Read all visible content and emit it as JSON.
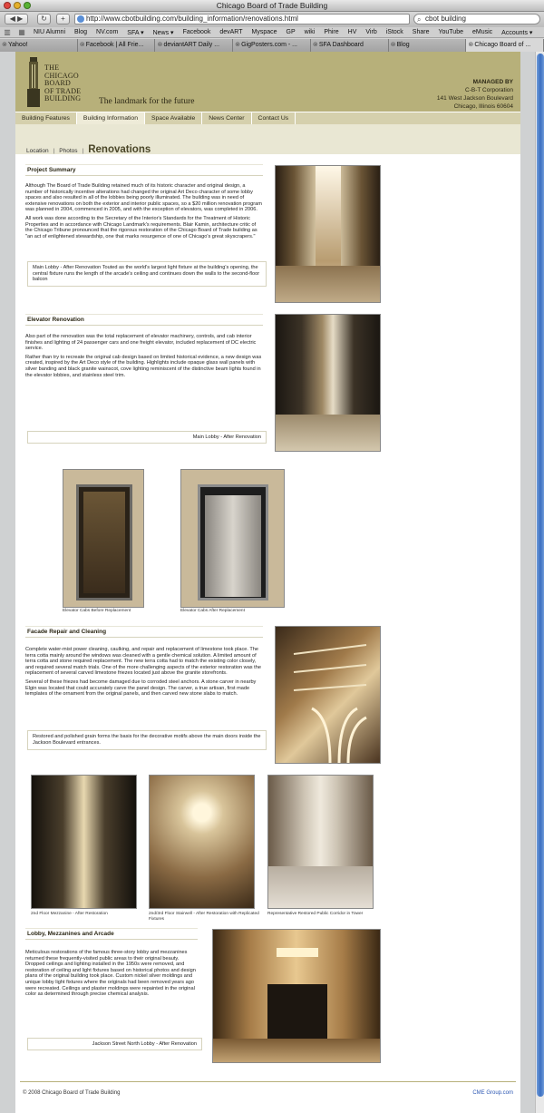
{
  "browser": {
    "window_title": "Chicago Board of Trade Building",
    "url": "http://www.cbotbuilding.com/building_information/renovations.html",
    "search_value": "cbot building",
    "bookmarks": [
      "NIU Alumni",
      "Blog",
      "NV.com",
      "SFA ▾",
      "News ▾",
      "Facebook",
      "devART",
      "Myspace",
      "GP",
      "wiki",
      "Phire",
      "HV",
      "Virb",
      "iStock",
      "Share",
      "YouTube",
      "eMusic",
      "Accounts ▾"
    ],
    "tabs": [
      "Yahoo!",
      "Facebook | All Frie...",
      "deviantART Daily ...",
      "GigPosters.com - ...",
      "SFA Dashboard",
      "Blog",
      "Chicago Board of ..."
    ],
    "active_tab_index": 6
  },
  "header": {
    "logo_lines": [
      "THE",
      "CHICAGO",
      "BOARD",
      "OF TRADE",
      "BUILDING"
    ],
    "tagline": "The landmark for the future",
    "managed_heading": "MANAGED BY",
    "managed_lines": [
      "C-B-T Corporation",
      "141 West Jackson Boulevard",
      "Chicago, Illinois 60604"
    ]
  },
  "nav": [
    "Building Features",
    "Building Information",
    "Space Available",
    "News Center",
    "Contact Us"
  ],
  "nav_current_index": 1,
  "subnav": {
    "location": "Location",
    "photos": "Photos",
    "heading": "Renovations"
  },
  "sections": {
    "summary": {
      "title": "Project Summary",
      "p1": "Although The Board of Trade Building retained much of its historic character and original design, a number of historically incentive alterations had changed the original Art Deco character of some lobby spaces and also resulted in all of the lobbies being poorly illuminated. The building was in need of extensive renovations on both the exterior and interior public spaces, so a $20 million renovation program was planned in 2004, commenced in 2005, and with the exception of elevators, was completed in 2006.",
      "p2": "All work was done according to the Secretary of the Interior's Standards for the Treatment of Historic Properties and in accordance with Chicago Landmark's requirements. Blair Kamin, architecture critic of the Chicago Tribune pronounced that the rigorous restoration of the Chicago Board of Trade building as \"an act of enlightened stewardship, one that marks resurgence of one of Chicago's great skyscrapers.\"",
      "caption": "Main Lobby - After Renovation Touted as the world's largest light fixture at the building's opening, the central fixture runs the length of the arcade's ceiling and continues down the walls to the second-floor balcon"
    },
    "elevator": {
      "title": "Elevator Renovation",
      "p1": "Also part of the renovation was the total replacement of elevator machinery, controls, and cab interior finishes and lighting of 24 passenger cars and one freight elevator, included replacement of DC electric service.",
      "p2": "Rather than try to recreate the original cab design based on limited historical evidence, a new design was created, inspired by the Art Deco style of the building. Highlights include opaque glass wall panels with silver banding and black granite wainscot, cove lighting reminiscent of the distinctive beam lights found in the elevator lobbies, and stainless steel trim.",
      "caption": "Main Lobby - After Renovation",
      "cab_before": "Elevator Cabs Before Replacement",
      "cab_after": "Elevator Cabs After Replacement"
    },
    "facade": {
      "title": "Facade Repair and Cleaning",
      "p1": "Complete water-mist power cleaning, caulking, and repair and replacement of limestone took place. The terra cotta mainly around the windows was cleaned with a gentle chemical solution. A limited amount of terra cotta and stone required replacement. The new terra cotta had to match the existing color closely, and required several match trials. One of the more challenging aspects of the exterior restoration was the replacement of several carved limestone friezes located just above the granite storefronts.",
      "p2": "Several of these friezes had become damaged due to corroded steel anchors. A stone carver in nearby Elgin was located that could accurately carve the panel design. The carver, a true artisan, first made templates of the ornament from the original panels, and then carved new stone slabs to match.",
      "caption": "Restored and polished grain forms the basis for the decorative motifs above the main doors inside the Jackson Boulevard entrances."
    },
    "gallery": {
      "cap1": "2nd Floor Mezzanine - After Restoration",
      "cap2": "2nd/3rd Floor Stairwell - After Restoration with Replicated Fixtures",
      "cap3": "Representative Restored Public Corridor in Tower"
    },
    "lobby": {
      "title": "Lobby, Mezzanines and Arcade",
      "p1": "Meticulous restorations of the famous three-story lobby and mezzanines returned these frequently-visited public areas to their original beauty. Dropped ceilings and lighting installed in the 1950s were removed, and restoration of ceiling and light fixtures based on historical photos and design plans of the original building took place. Custom nickel silver moldings and unique lobby light fixtures where the originals had been removed years ago were recreated. Ceilings and plaster moldings were repainted in the original color as determined through precise chemical analysis.",
      "caption": "Jackson Street North Lobby - After Renovation"
    }
  },
  "footer": {
    "copyright": "© 2008 Chicago Board of Trade Building",
    "link": "CME Group.com"
  }
}
